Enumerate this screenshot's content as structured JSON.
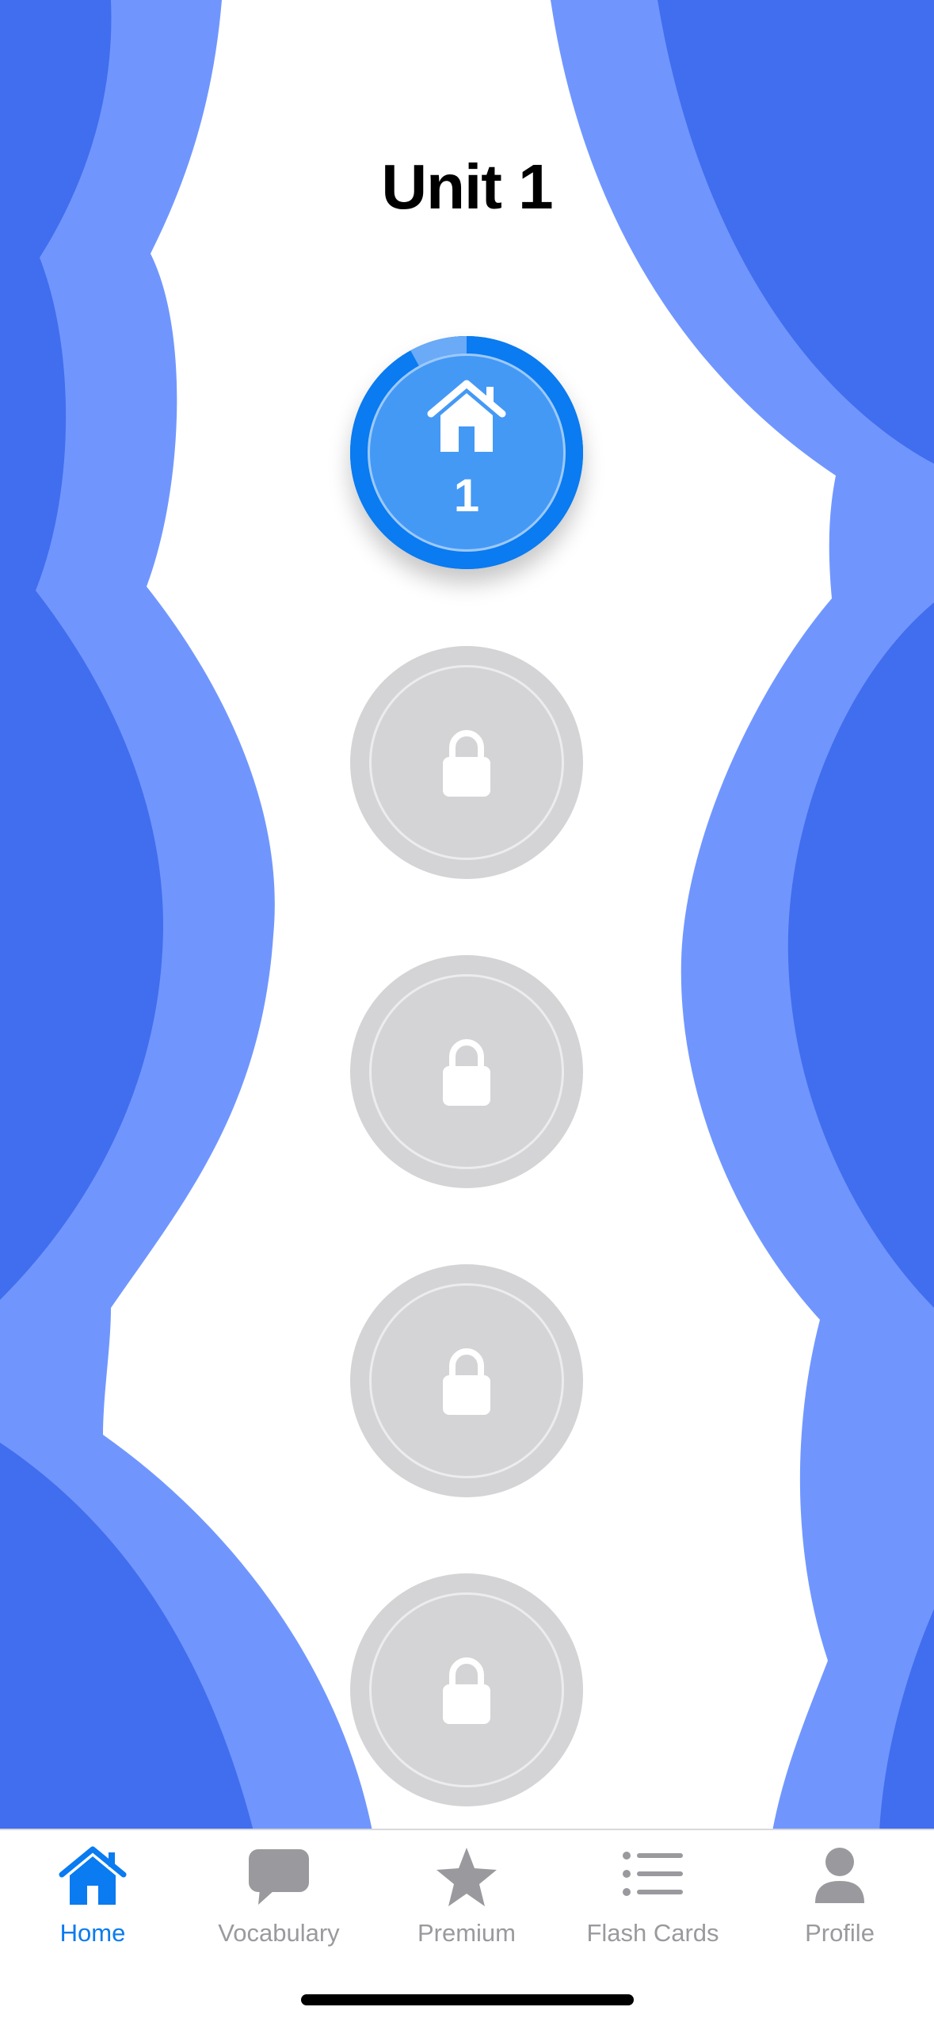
{
  "unit_title": "Unit 1",
  "colors": {
    "accent": "#0A7BF0",
    "background_dark": "#416EEE",
    "background_light": "#7096FE",
    "locked": "#D4D4D6",
    "tab_inactive": "#9A9A9E"
  },
  "path": {
    "active_lesson": {
      "icon": "house-icon",
      "number": "1",
      "progress": 0.08
    },
    "locked_lessons": [
      {
        "icon": "lock-icon"
      },
      {
        "icon": "lock-icon"
      },
      {
        "icon": "lock-icon"
      },
      {
        "icon": "lock-icon"
      }
    ]
  },
  "tab_bar": {
    "tabs": [
      {
        "label": "Home",
        "icon": "house-icon",
        "selected": true
      },
      {
        "label": "Vocabulary",
        "icon": "speech-bubble-icon",
        "selected": false
      },
      {
        "label": "Premium",
        "icon": "star-icon",
        "selected": false
      },
      {
        "label": "Flash Cards",
        "icon": "list-icon",
        "selected": false
      },
      {
        "label": "Profile",
        "icon": "person-icon",
        "selected": false
      }
    ]
  }
}
